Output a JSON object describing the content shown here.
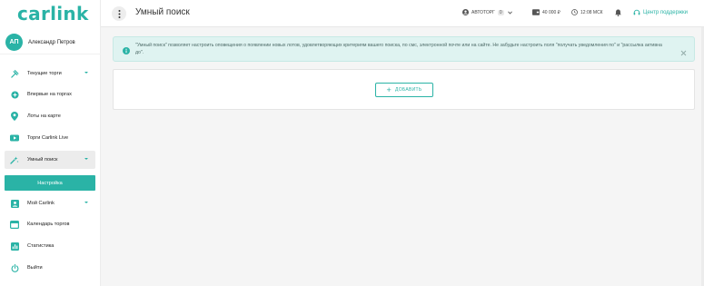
{
  "brand": {
    "logo_text": "carlink",
    "accent_color": "#2ab3a6"
  },
  "user": {
    "initials": "АП",
    "name": "Александр Петров"
  },
  "sidebar": {
    "items": [
      {
        "label": "Текущие торги",
        "icon": "auction-icon",
        "has_chevron": true
      },
      {
        "label": "Впервые на торгах",
        "icon": "plus-circle-icon",
        "has_chevron": false
      },
      {
        "label": "Лоты на карте",
        "icon": "map-pin-icon",
        "has_chevron": false
      },
      {
        "label": "Торги Carlink Live",
        "icon": "live-icon",
        "has_chevron": false
      },
      {
        "label": "Умный поиск",
        "icon": "smart-search-icon",
        "has_chevron": true
      },
      {
        "label": "Настройка",
        "icon": "",
        "has_chevron": false
      },
      {
        "label": "Мой Carlink",
        "icon": "account-box-icon",
        "has_chevron": true
      },
      {
        "label": "Календарь торгов",
        "icon": "calendar-icon",
        "has_chevron": false
      },
      {
        "label": "Статистика",
        "icon": "stats-icon",
        "has_chevron": false
      },
      {
        "label": "Выйти",
        "icon": "power-icon",
        "has_chevron": false
      }
    ]
  },
  "topbar": {
    "title": "Умный поиск",
    "autotorg_label": "АВТОТОРГ",
    "autotorg_count": "0",
    "balance": "40 000 ₽",
    "time": "12:08 МСК",
    "support_label": "Центр поддержки"
  },
  "banner": {
    "text": "\"Умный поиск\" позволяет настроить оповещения о появлении новых лотов, удовлетворяющих критериям вашего поиска, по смс, электронной почте или на сайте. Не забудьте настроить поля \"получать уведомления по\" и \"рассылка активна до\"."
  },
  "main": {
    "add_button_label": "ДОБАВИТЬ"
  }
}
